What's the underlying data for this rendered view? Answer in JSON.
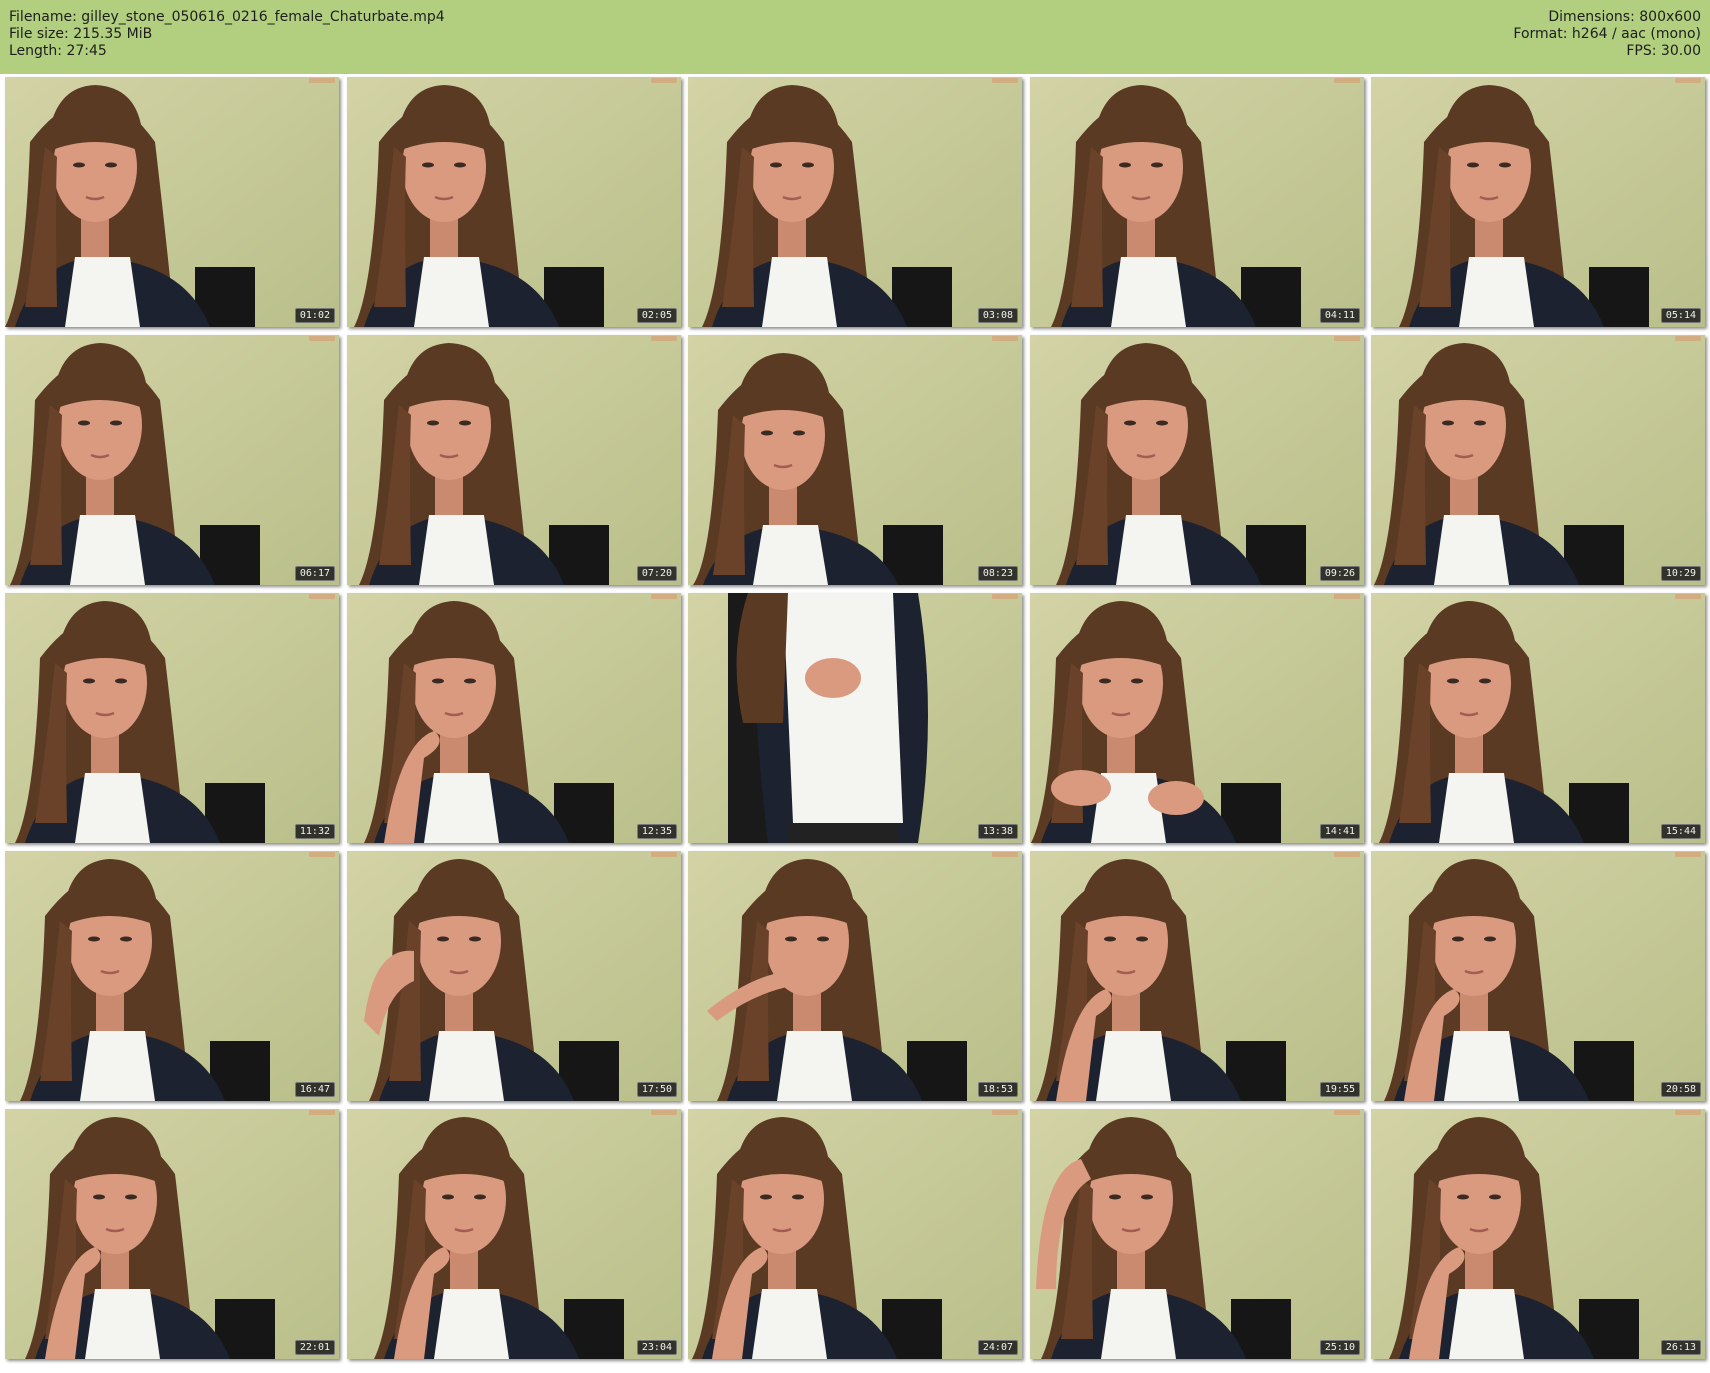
{
  "header": {
    "filename": "Filename: gilley_stone_050616_0216_female_Chaturbate.mp4",
    "file_size": "File size: 215.35 MiB",
    "length": "Length: 27:45",
    "dimensions": "Dimensions: 800x600",
    "format": "Format: h264 / aac (mono)",
    "fps": "FPS: 30.00"
  },
  "colors": {
    "header_bg": "#b1cf7e",
    "wall": "#cfcf9e",
    "hair": "#5b3a24",
    "skin": "#d99a80",
    "jacket": "#1d2230",
    "shirt": "#f4f4f0",
    "timestamp_bg": "#191919"
  },
  "thumbnails": [
    {
      "time": "01:02",
      "pose": "normal"
    },
    {
      "time": "02:05",
      "pose": "normal"
    },
    {
      "time": "03:08",
      "pose": "normal"
    },
    {
      "time": "04:11",
      "pose": "normal"
    },
    {
      "time": "05:14",
      "pose": "normal"
    },
    {
      "time": "06:17",
      "pose": "normal"
    },
    {
      "time": "07:20",
      "pose": "normal"
    },
    {
      "time": "08:23",
      "pose": "lower"
    },
    {
      "time": "09:26",
      "pose": "normal"
    },
    {
      "time": "10:29",
      "pose": "normal"
    },
    {
      "time": "11:32",
      "pose": "normal"
    },
    {
      "time": "12:35",
      "pose": "hand-chin"
    },
    {
      "time": "13:38",
      "pose": "standing"
    },
    {
      "time": "14:41",
      "pose": "hands-chest"
    },
    {
      "time": "15:44",
      "pose": "normal"
    },
    {
      "time": "16:47",
      "pose": "normal"
    },
    {
      "time": "17:50",
      "pose": "hand-cheek"
    },
    {
      "time": "18:53",
      "pose": "hand-mouth"
    },
    {
      "time": "19:55",
      "pose": "hand-chin"
    },
    {
      "time": "20:58",
      "pose": "hand-chin"
    },
    {
      "time": "22:01",
      "pose": "hand-chin"
    },
    {
      "time": "23:04",
      "pose": "hand-chin"
    },
    {
      "time": "24:07",
      "pose": "hand-chin"
    },
    {
      "time": "25:10",
      "pose": "hand-head"
    },
    {
      "time": "26:13",
      "pose": "hand-chin"
    }
  ]
}
